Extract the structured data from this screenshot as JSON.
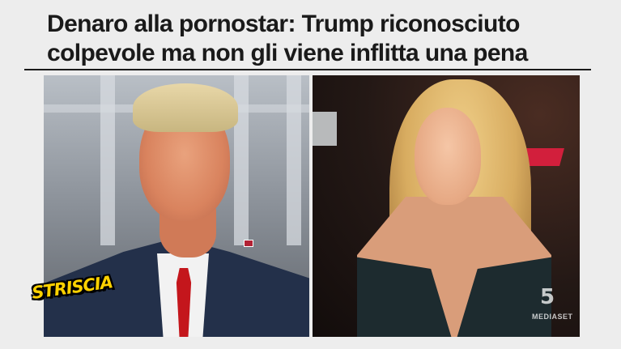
{
  "headline": {
    "line1": "Denaro alla pornostar: Trump riconosciuto",
    "line2": "colpevole ma non gli viene inflitta una pena"
  },
  "overlay": {
    "show_logo": "STRISCIA",
    "channel_watermark": "MEDIASET",
    "channel_number": "5"
  },
  "colors": {
    "headline_text": "#1a1a1a",
    "logo_yellow": "#ffd200",
    "tie_red": "#c4161c"
  }
}
